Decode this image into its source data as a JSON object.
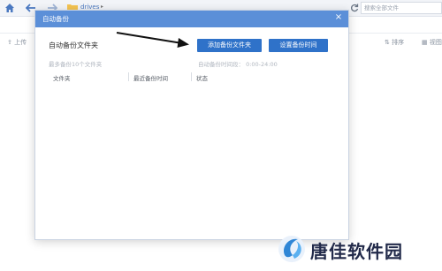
{
  "app": {
    "breadcrumb": "drives",
    "search_placeholder": "搜索全部文件",
    "toolbar": {
      "upload_label": "上传",
      "sort_label": "排序",
      "view_label": "视图"
    }
  },
  "modal": {
    "title": "自动备份",
    "close_symbol": "×",
    "section_title": "自动备份文件夹",
    "add_button": "添加备份文件夹",
    "time_button": "设置备份时间",
    "hint_max": "最多备份10个文件夹",
    "hint_time": "自动备份时间段： 0:00-24:00",
    "columns": [
      "文件夹",
      "最近备份时间",
      "状态"
    ]
  },
  "watermark": {
    "text": "唐佳软件园"
  },
  "colors": {
    "header_blue": "#5b8fd8",
    "button_blue": "#2f72c9"
  }
}
